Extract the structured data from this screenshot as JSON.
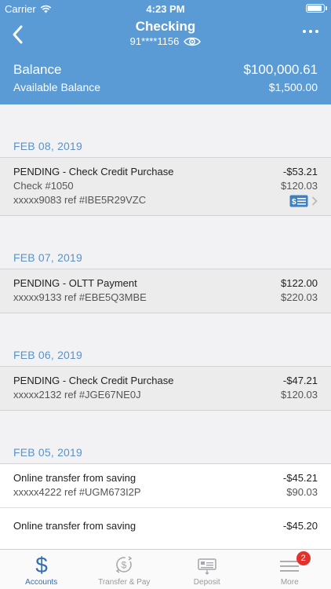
{
  "status_bar": {
    "carrier": "Carrier",
    "time": "4:23 PM"
  },
  "header": {
    "title": "Checking",
    "account_number": "91****1156",
    "balance_label": "Balance",
    "balance_value": "$100,000.61",
    "available_label": "Available Balance",
    "available_value": "$1,500.00"
  },
  "sections": [
    {
      "date": "FEB 08, 2019",
      "transactions": [
        {
          "title": "PENDING - Check Credit Purchase",
          "amount": "-$53.21",
          "line2": "Check #1050",
          "line2_amount": "$120.03",
          "line3": "xxxxx9083 ref #IBE5R29VZC"
        }
      ]
    },
    {
      "date": "FEB 07, 2019",
      "transactions": [
        {
          "title": "PENDING - OLTT Payment",
          "amount": "$122.00",
          "line2": "xxxxx9133 ref #EBE5Q3MBE",
          "line2_amount": "$220.03"
        }
      ]
    },
    {
      "date": "FEB 06, 2019",
      "transactions": [
        {
          "title": "PENDING - Check Credit Purchase",
          "amount": "-$47.21",
          "line2": "xxxxx2132 ref #JGE67NE0J",
          "line2_amount": "$120.03"
        }
      ]
    },
    {
      "date": "FEB 05, 2019",
      "transactions": [
        {
          "title": "Online transfer from saving",
          "amount": "-$45.21",
          "line2": "xxxxx4222 ref #UGM673I2P",
          "line2_amount": "$90.03"
        },
        {
          "title": "Online transfer from saving",
          "amount": "-$45.20",
          "line2": "",
          "line2_amount": ""
        }
      ]
    }
  ],
  "tabbar": {
    "tabs": [
      {
        "label": "Accounts"
      },
      {
        "label": "Transfer & Pay"
      },
      {
        "label": "Deposit"
      },
      {
        "label": "More",
        "badge": "2"
      }
    ]
  },
  "colors": {
    "header": "#5b9bd5",
    "accent": "#2f6fb3",
    "date": "#5b92c6",
    "badge": "#e5312b"
  }
}
